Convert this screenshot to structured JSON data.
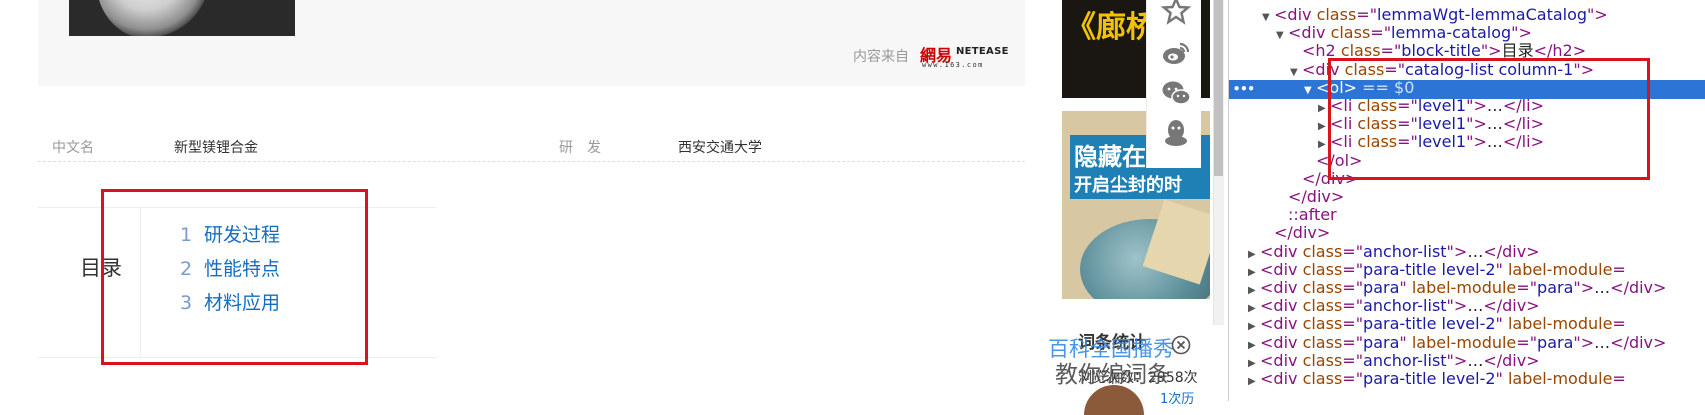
{
  "content": {
    "source_label": "内容来自",
    "netease_logo": {
      "cn": "網易",
      "en": "NETEASE",
      "url": "www.163.com"
    },
    "basic_info": [
      {
        "name": "中文名",
        "value": "新型镁锂合金"
      },
      {
        "name": "研　发",
        "value": "西安交通大学"
      }
    ],
    "catalog": {
      "title": "目录",
      "items": [
        {
          "num": "1",
          "label": "研发过程"
        },
        {
          "num": "2",
          "label": "性能特点"
        },
        {
          "num": "3",
          "label": "材料应用"
        }
      ]
    }
  },
  "ads": {
    "top_ad_text": "《廊桥",
    "mid_ad_title": "隐藏在",
    "mid_ad_subtitle": "开启尘封的时"
  },
  "share_icons": [
    "star-icon",
    "weibo-icon",
    "wechat-icon",
    "qq-icon"
  ],
  "sidebar": {
    "stats_title": "词条统计",
    "views": "浏览次数：2958次",
    "more": "1次历",
    "promo_line1": "百科全国播秀",
    "promo_line2": "教你编词条"
  },
  "devtools": {
    "selection_dots": "•••",
    "lines": [
      {
        "indent": 0,
        "tri": "▼",
        "html": [
          [
            "t",
            "<div "
          ],
          [
            "an",
            "class"
          ],
          [
            "t",
            "=\""
          ],
          [
            "av",
            "lemmaWgt-lemmaCatalog"
          ],
          [
            "t",
            "\">"
          ]
        ]
      },
      {
        "indent": 1,
        "tri": "▼",
        "html": [
          [
            "t",
            "<div "
          ],
          [
            "an",
            "class"
          ],
          [
            "t",
            "=\""
          ],
          [
            "av",
            "lemma-catalog"
          ],
          [
            "t",
            "\">"
          ]
        ]
      },
      {
        "indent": 2,
        "tri": "",
        "html": [
          [
            "t",
            "<h2 "
          ],
          [
            "an",
            "class"
          ],
          [
            "t",
            "=\""
          ],
          [
            "av",
            "block-title"
          ],
          [
            "t",
            "\">"
          ],
          [
            "tx",
            "目录"
          ],
          [
            "t",
            "</h2>"
          ]
        ]
      },
      {
        "indent": 2,
        "tri": "▼",
        "html": [
          [
            "t",
            "<div "
          ],
          [
            "an",
            "class"
          ],
          [
            "t",
            "=\""
          ],
          [
            "av",
            "catalog-list column-1"
          ],
          [
            "t",
            "\">"
          ]
        ]
      },
      {
        "indent": 3,
        "tri": "▼",
        "selected": true,
        "html": [
          [
            "t",
            "<ol>"
          ],
          [
            "eq",
            " == $0"
          ]
        ]
      },
      {
        "indent": 4,
        "tri": "▶",
        "html": [
          [
            "t",
            "<li "
          ],
          [
            "an",
            "class"
          ],
          [
            "t",
            "=\""
          ],
          [
            "av",
            "level1"
          ],
          [
            "t",
            "\">"
          ],
          [
            "tx",
            "…"
          ],
          [
            "t",
            "</li>"
          ]
        ]
      },
      {
        "indent": 4,
        "tri": "▶",
        "html": [
          [
            "t",
            "<li "
          ],
          [
            "an",
            "class"
          ],
          [
            "t",
            "=\""
          ],
          [
            "av",
            "level1"
          ],
          [
            "t",
            "\">"
          ],
          [
            "tx",
            "…"
          ],
          [
            "t",
            "</li>"
          ]
        ]
      },
      {
        "indent": 4,
        "tri": "▶",
        "html": [
          [
            "t",
            "<li "
          ],
          [
            "an",
            "class"
          ],
          [
            "t",
            "=\""
          ],
          [
            "av",
            "level1"
          ],
          [
            "t",
            "\">"
          ],
          [
            "tx",
            "…"
          ],
          [
            "t",
            "</li>"
          ]
        ]
      },
      {
        "indent": 3,
        "tri": "",
        "html": [
          [
            "t",
            "</ol>"
          ]
        ]
      },
      {
        "indent": 2,
        "tri": "",
        "html": [
          [
            "t",
            "</div>"
          ]
        ]
      },
      {
        "indent": 1,
        "tri": "",
        "html": [
          [
            "t",
            "</div>"
          ]
        ]
      },
      {
        "indent": 1,
        "tri": "",
        "html": [
          [
            "ps",
            "::after"
          ]
        ]
      },
      {
        "indent": 0,
        "tri": "",
        "html": [
          [
            "t",
            "</div>"
          ]
        ]
      },
      {
        "indent": -1,
        "tri": "▶",
        "html": [
          [
            "t",
            "<div "
          ],
          [
            "an",
            "class"
          ],
          [
            "t",
            "=\""
          ],
          [
            "av",
            "anchor-list"
          ],
          [
            "t",
            "\">"
          ],
          [
            "tx",
            "…"
          ],
          [
            "t",
            "</div>"
          ]
        ]
      },
      {
        "indent": -1,
        "tri": "▶",
        "html": [
          [
            "t",
            "<div "
          ],
          [
            "an",
            "class"
          ],
          [
            "t",
            "=\""
          ],
          [
            "av",
            "para-title level-2"
          ],
          [
            "t",
            "\" "
          ],
          [
            "an",
            "label-module"
          ],
          [
            "t",
            "="
          ]
        ]
      },
      {
        "indent": -1,
        "tri": "▶",
        "html": [
          [
            "t",
            "<div "
          ],
          [
            "an",
            "class"
          ],
          [
            "t",
            "=\""
          ],
          [
            "av",
            "para"
          ],
          [
            "t",
            "\" "
          ],
          [
            "an",
            "label-module"
          ],
          [
            "t",
            "=\""
          ],
          [
            "av",
            "para"
          ],
          [
            "t",
            "\">"
          ],
          [
            "tx",
            "…"
          ],
          [
            "t",
            "</div>"
          ]
        ]
      },
      {
        "indent": -1,
        "tri": "▶",
        "html": [
          [
            "t",
            "<div "
          ],
          [
            "an",
            "class"
          ],
          [
            "t",
            "=\""
          ],
          [
            "av",
            "anchor-list"
          ],
          [
            "t",
            "\">"
          ],
          [
            "tx",
            "…"
          ],
          [
            "t",
            "</div>"
          ]
        ]
      },
      {
        "indent": -1,
        "tri": "▶",
        "html": [
          [
            "t",
            "<div "
          ],
          [
            "an",
            "class"
          ],
          [
            "t",
            "=\""
          ],
          [
            "av",
            "para-title level-2"
          ],
          [
            "t",
            "\" "
          ],
          [
            "an",
            "label-module"
          ],
          [
            "t",
            "="
          ]
        ]
      },
      {
        "indent": -1,
        "tri": "▶",
        "html": [
          [
            "t",
            "<div "
          ],
          [
            "an",
            "class"
          ],
          [
            "t",
            "=\""
          ],
          [
            "av",
            "para"
          ],
          [
            "t",
            "\" "
          ],
          [
            "an",
            "label-module"
          ],
          [
            "t",
            "=\""
          ],
          [
            "av",
            "para"
          ],
          [
            "t",
            "\">"
          ],
          [
            "tx",
            "…"
          ],
          [
            "t",
            "</div>"
          ]
        ]
      },
      {
        "indent": -1,
        "tri": "▶",
        "html": [
          [
            "t",
            "<div "
          ],
          [
            "an",
            "class"
          ],
          [
            "t",
            "=\""
          ],
          [
            "av",
            "anchor-list"
          ],
          [
            "t",
            "\">"
          ],
          [
            "tx",
            "…"
          ],
          [
            "t",
            "</div>"
          ]
        ]
      },
      {
        "indent": -1,
        "tri": "▶",
        "html": [
          [
            "t",
            "<div "
          ],
          [
            "an",
            "class"
          ],
          [
            "t",
            "=\""
          ],
          [
            "av",
            "para-title level-2"
          ],
          [
            "t",
            "\" "
          ],
          [
            "an",
            "label-module"
          ],
          [
            "t",
            "="
          ]
        ]
      }
    ]
  },
  "colors": {
    "link_blue": "#136ec2",
    "highlight_red": "#d9141d",
    "devtools_selection": "#2c74d6"
  }
}
